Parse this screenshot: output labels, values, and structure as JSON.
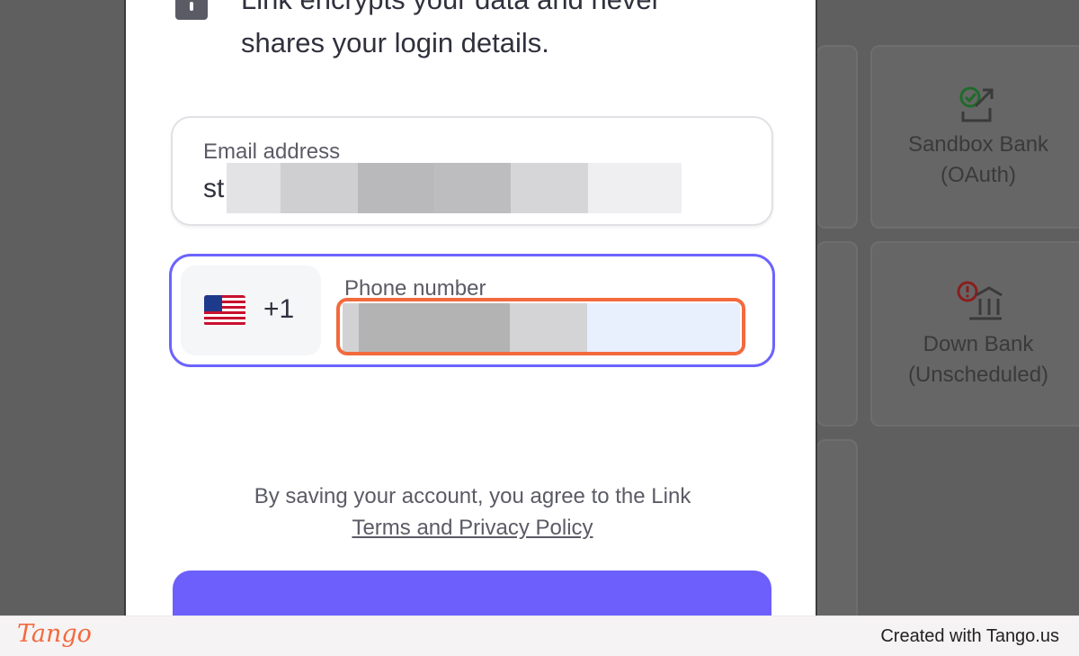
{
  "background_tiles": [
    {
      "label_line1": "Sandbox Bank",
      "label_line2": "(OAuth)",
      "icon": "check-external-link-icon"
    },
    {
      "label_line1": "Down Bank",
      "label_line2": "(Unscheduled)",
      "icon": "alert-bank-icon"
    }
  ],
  "modal": {
    "encrypt_text": "Link encrypts your data and never shares your login details.",
    "email": {
      "label": "Email address",
      "visible_value": "st"
    },
    "phone": {
      "label": "Phone number",
      "country_code": "+1",
      "country_flag": "us-flag-icon"
    },
    "agreement_text": "By saving your account, you agree to the Link",
    "agreement_link": "Terms and Privacy Policy"
  },
  "footer": {
    "logo": "Tango",
    "created_text": "Created with Tango.us"
  },
  "colors": {
    "accent": "#6c63ff",
    "button": "#6c5ffb",
    "highlight": "#f26a3d",
    "overlay": "#5f5f5f"
  }
}
